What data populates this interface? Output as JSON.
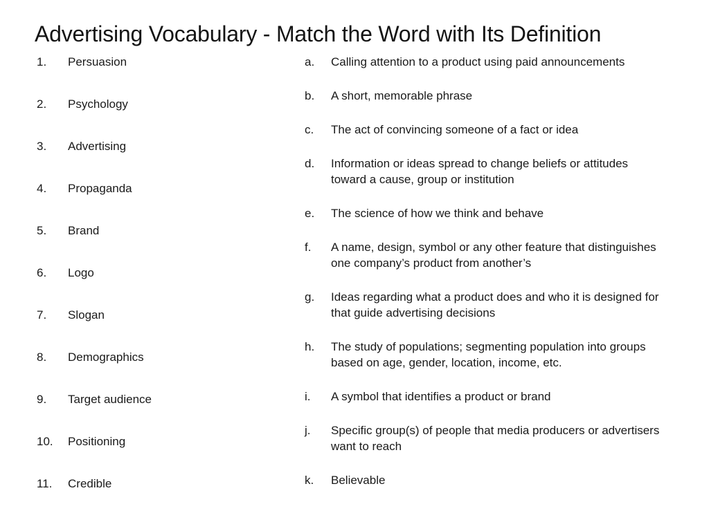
{
  "slide": {
    "title": "Advertising Vocabulary - Match the Word with Its Definition",
    "background_color": "#ffffff",
    "text_color": "#1a1a1a"
  },
  "words_column": {
    "items": [
      {
        "marker": "1.",
        "label": "Persuasion"
      },
      {
        "marker": "2.",
        "label": "Psychology"
      },
      {
        "marker": "3.",
        "label": "Advertising"
      },
      {
        "marker": "4.",
        "label": "Propaganda"
      },
      {
        "marker": "5.",
        "label": "Brand"
      },
      {
        "marker": "6.",
        "label": "Logo"
      },
      {
        "marker": "7.",
        "label": "Slogan"
      },
      {
        "marker": "8.",
        "label": "Demographics"
      },
      {
        "marker": "9.",
        "label": "Target audience"
      },
      {
        "marker": "10.",
        "label": "Positioning"
      },
      {
        "marker": "11.",
        "label": "Credible"
      }
    ]
  },
  "definitions_column": {
    "items": [
      {
        "marker": "a.",
        "label": "Calling attention to a product using paid announcements"
      },
      {
        "marker": "b.",
        "label": "A short, memorable phrase"
      },
      {
        "marker": "c.",
        "label": "The act of convincing someone of a fact or idea"
      },
      {
        "marker": "d.",
        "label": "Information or ideas spread to change beliefs or attitudes\ntoward a cause, group or institution"
      },
      {
        "marker": "e.",
        "label": "The science of how we think and behave"
      },
      {
        "marker": "f.",
        "label": "A name, design, symbol or any other feature that distinguishes\none company’s product from another’s"
      },
      {
        "marker": "g.",
        "label": "Ideas regarding what a product does and who it is designed for\nthat guide advertising decisions"
      },
      {
        "marker": "h.",
        "label": "The study of populations; segmenting population into groups\nbased on age, gender, location, income, etc."
      },
      {
        "marker": "i.",
        "label": "A symbol that identifies a product or brand"
      },
      {
        "marker": "j.",
        "label": "Specific group(s) of people that media producers or advertisers\nwant to reach"
      },
      {
        "marker": "k.",
        "label": "Believable"
      }
    ]
  }
}
